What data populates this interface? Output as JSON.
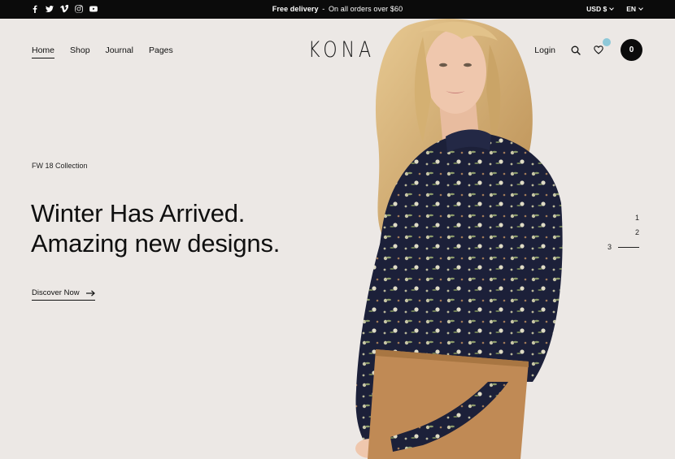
{
  "topbar": {
    "social_icons": [
      "facebook-icon",
      "twitter-icon",
      "vimeo-icon",
      "instagram-icon",
      "youtube-icon"
    ],
    "promo_bold": "Free delivery",
    "promo_rest": "On all orders over $60",
    "currency": "USD $",
    "language": "EN"
  },
  "header": {
    "nav": [
      "Home",
      "Shop",
      "Journal",
      "Pages"
    ],
    "logo": "KONA",
    "login": "Login",
    "cart_count": "0"
  },
  "hero": {
    "eyebrow": "FW 18 Collection",
    "headline_line1": "Winter Has Arrived.",
    "headline_line2": "Amazing new designs.",
    "cta": "Discover Now",
    "slides": [
      "1",
      "2",
      "3"
    ],
    "active_slide": "3"
  },
  "colors": {
    "background": "#ece8e5",
    "topbar": "#0b0b0b",
    "wishlist_badge": "#8ec8d8",
    "blouse": "#1c2039",
    "skirt": "#c08a55",
    "hair": "#d8b67a",
    "skin": "#efc7ad"
  }
}
